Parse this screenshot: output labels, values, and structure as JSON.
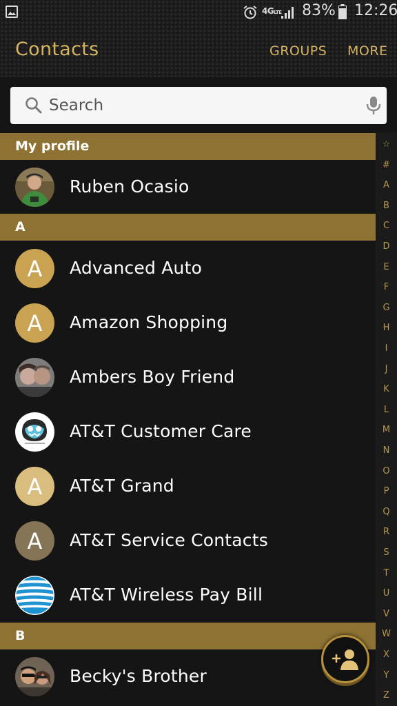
{
  "status_bar": {
    "network": "4G",
    "network_sub": "LTE",
    "battery": "83%",
    "time": "12:26",
    "icons": [
      "gallery-icon",
      "alarm-icon",
      "signal-icon",
      "battery-icon"
    ]
  },
  "header": {
    "title": "Contacts",
    "groups_label": "GROUPS",
    "more_label": "MORE"
  },
  "search": {
    "placeholder": "Search"
  },
  "sections": [
    {
      "header": "My profile",
      "contacts": [
        {
          "name": "Ruben Ocasio",
          "avatar": "photo"
        }
      ]
    },
    {
      "header": "A",
      "contacts": [
        {
          "name": "Advanced Auto",
          "avatar": "letter",
          "letter": "A",
          "color": "#c9a352"
        },
        {
          "name": "Amazon Shopping",
          "avatar": "letter",
          "letter": "A",
          "color": "#c9a352"
        },
        {
          "name": "Ambers Boy Friend",
          "avatar": "photo"
        },
        {
          "name": "AT&T Customer Care",
          "avatar": "photo"
        },
        {
          "name": "AT&T Grand",
          "avatar": "letter",
          "letter": "A",
          "color": "#d8bd7e"
        },
        {
          "name": "AT&T Service Contacts",
          "avatar": "letter",
          "letter": "A",
          "color": "#857456"
        },
        {
          "name": "AT&T Wireless Pay Bill",
          "avatar": "globe"
        }
      ]
    },
    {
      "header": "B",
      "contacts": [
        {
          "name": "Becky's Brother",
          "avatar": "photo"
        }
      ]
    }
  ],
  "index_bar": [
    "☆",
    "#",
    "A",
    "B",
    "C",
    "D",
    "E",
    "F",
    "G",
    "H",
    "I",
    "J",
    "K",
    "L",
    "M",
    "N",
    "O",
    "P",
    "Q",
    "R",
    "S",
    "T",
    "U",
    "V",
    "W",
    "X",
    "Y",
    "Z"
  ],
  "colors": {
    "accent": "#d6b461",
    "section_bar": "#8d7233",
    "background": "#151515"
  },
  "fab": {
    "icon": "add-contact-icon"
  }
}
